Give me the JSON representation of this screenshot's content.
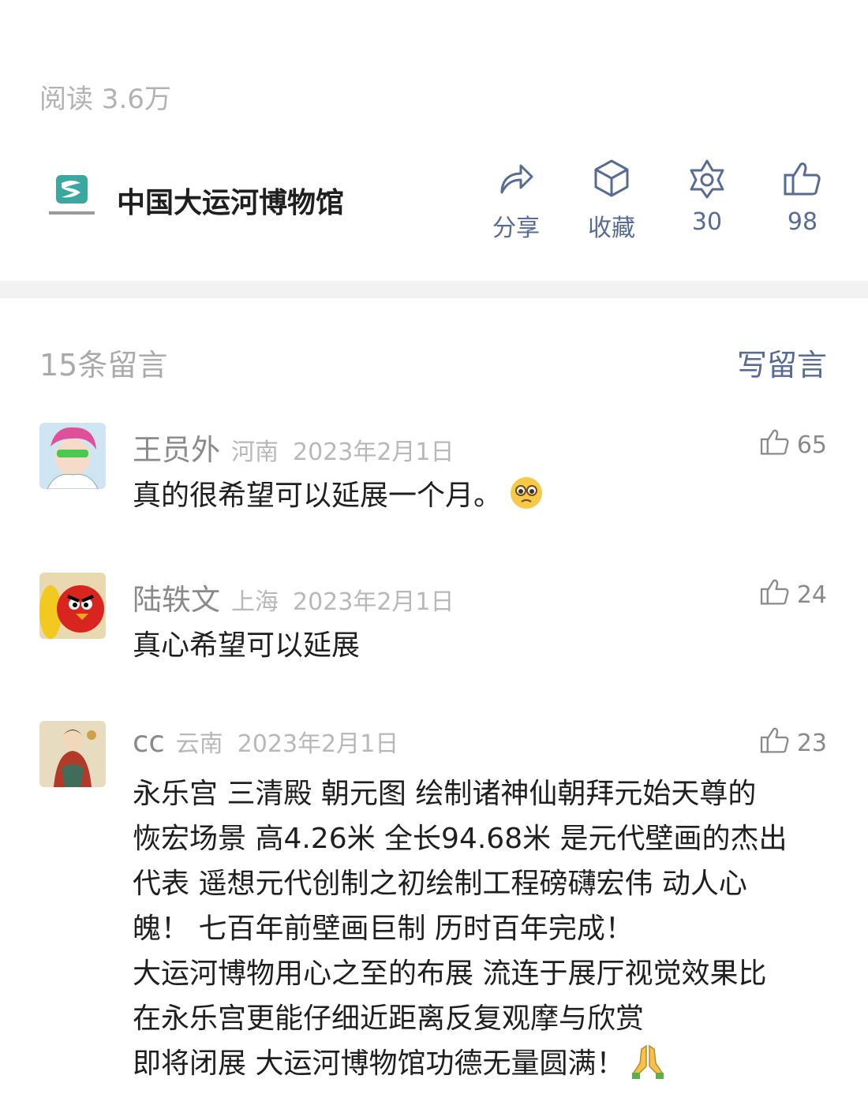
{
  "article": {
    "read_count": "阅读 3.6万"
  },
  "author": {
    "name": "中国大运河博物馆",
    "logo_icon": "grand-canal-museum-logo"
  },
  "actions": [
    {
      "name": "share",
      "label": "分享",
      "icon": "share-arrow-icon"
    },
    {
      "name": "favorite",
      "label": "收藏",
      "icon": "cube-icon"
    },
    {
      "name": "wow",
      "label": "30",
      "icon": "flower-icon"
    },
    {
      "name": "like",
      "label": "98",
      "icon": "thumbs-up-icon"
    }
  ],
  "comments_section": {
    "count_label": "15条留言",
    "write_label": "写留言"
  },
  "comments": [
    {
      "nickname": "王员外",
      "location": "河南",
      "date": "2023年2月1日",
      "likes": "65",
      "lines": [
        "真的很希望可以延展一个月。"
      ],
      "emoji": "pleading-face"
    },
    {
      "nickname": "陆轶文",
      "location": "上海",
      "date": "2023年2月1日",
      "likes": "24",
      "lines": [
        "真心希望可以延展"
      ]
    },
    {
      "nickname": "cc",
      "location": "云南",
      "date": "2023年2月1日",
      "likes": "23",
      "lines": [
        "永乐宫 三清殿 朝元图 绘制诸神仙朝拜元始天尊的",
        "恢宏场景 高4.26米 全长94.68米 是元代壁画的杰出",
        "代表 遥想元代创制之初绘制工程磅礴宏伟 动人心",
        "魄！ 七百年前壁画巨制 历时百年完成！",
        "大运河博物用心之至的布展 流连于展厅视觉效果比",
        "在永乐宫更能仔细近距离反复观摩与欣赏",
        "即将闭展 大运河博物馆功德无量圆满！"
      ],
      "emoji": "folded-hands"
    }
  ],
  "colors": {
    "link": "#576b95",
    "muted": "#b2b2b2",
    "text": "#1f1f1f",
    "divider": "#f2f2f2"
  }
}
